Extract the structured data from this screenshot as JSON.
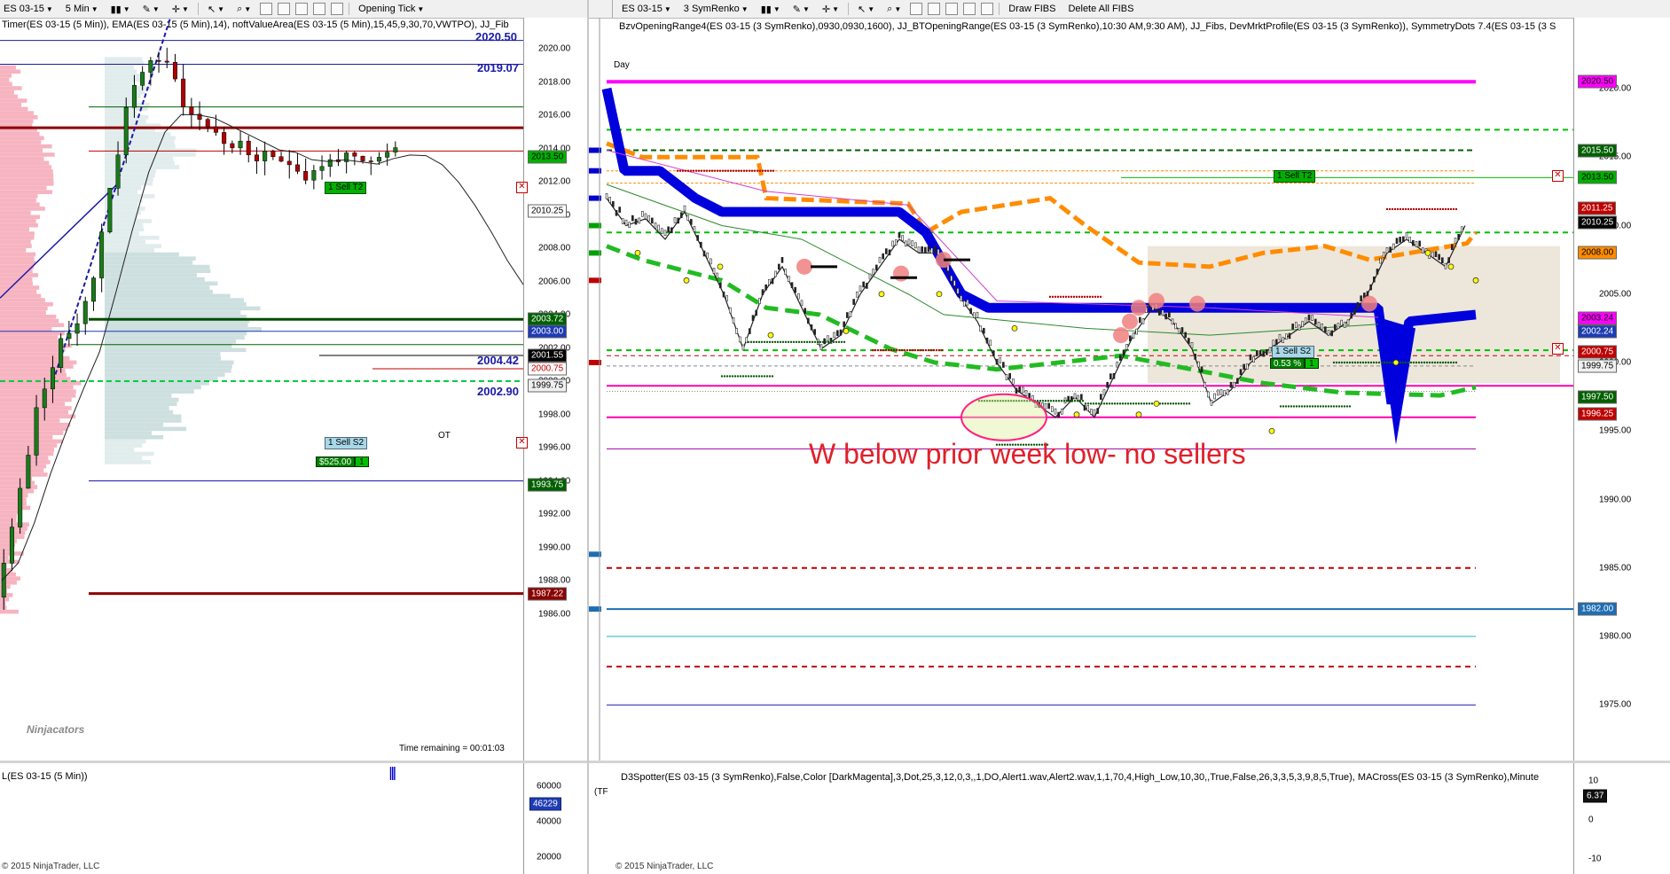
{
  "left_chart": {
    "toolbar": {
      "instrument": "ES 03-15",
      "interval": "5 Min",
      "template": "Opening Tick"
    },
    "indicator_line": "Timer(ES 03-15 (5 Min)), EMA(ES 03-15 (5 Min),14), noftValueArea(ES 03-15 (5 Min),15,45,9,30,70,VWTPO), JJ_Fib",
    "price_labels": [
      "2020.00",
      "2018.00",
      "2016.00",
      "2014.00",
      "2012.00",
      "2010.00",
      "2008.00",
      "2006.00",
      "2004.00",
      "2002.00",
      "2000.00",
      "1998.00",
      "1996.00",
      "1994.00",
      "1992.00",
      "1990.00",
      "1988.00",
      "1986.00"
    ],
    "level_labels": {
      "top": "2020.50",
      "fib1": "2019.07",
      "fib2": "2004.42",
      "fib3": "2002.90"
    },
    "axis_tags": {
      "sell_t2_price": "2013.50",
      "box_2010": "2010.25",
      "green_2003": "2003.72",
      "blue_2003": "2003.00",
      "black_2001": "2001.55",
      "red_2000": "2000.75",
      "gray_1999": "1999.75",
      "green_1993": "1993.75",
      "red_1987": "1987.22"
    },
    "order_labels": {
      "sell_t2": "Sell T2",
      "sell_t2_qty": "1",
      "sell_s2": "Sell S2",
      "sell_s2_qty": "1",
      "pnl": "$525.00",
      "pnl_qty": "1",
      "ot": "OT"
    },
    "watermark": "Ninjacators",
    "time_remaining": "Time remaining = 00:01:03",
    "volume_panel": {
      "label": "L(ES 03-15 (5 Min))",
      "axis_labels": [
        "60000",
        "40000",
        "20000"
      ],
      "current_value": "46229"
    },
    "copyright": "© 2015 NinjaTrader, LLC"
  },
  "right_chart": {
    "toolbar": {
      "instrument": "ES 03-15",
      "interval": "3 SymRenko",
      "draw_fibs": "Draw FIBS",
      "delete_fibs": "Delete All FIBS"
    },
    "indicator_line": "BzvOpeningRange4(ES 03-15 (3 SymRenko),0930,0930,1600), JJ_BTOpeningRange(ES 03-15 (3 SymRenko),10:30 AM,9:30 AM), JJ_Fibs, DevMrktProfile(ES 03-15 (3 SymRenko)), SymmetryDots 7.4(ES 03-15 (3 S",
    "price_labels": [
      "2020.00",
      "2015.00",
      "2010.00",
      "2005.00",
      "2000.00",
      "1995.00",
      "1990.00",
      "1985.00",
      "1980.00",
      "1975.00"
    ],
    "axis_tags": {
      "magenta_2020": "2020.50",
      "green_2015": "2015.50",
      "green_2013": "2013.50",
      "red_2011": "2011.25",
      "black_2010": "2010.25",
      "orange_2008": "2008.00",
      "magenta_2003": "2003.24",
      "blue_2002": "2002.24",
      "red_2000": "2000.75",
      "gray_1999": "1999.75",
      "green_1997": "1997.50",
      "red_1996": "1996.25",
      "blue_1982": "1982.00"
    },
    "order_labels": {
      "sell_t2": "Sell T2",
      "sell_t2_qty": "1",
      "sell_s2": "Sell S2",
      "sell_s2_qty": "1",
      "pct": "0.53 %",
      "pct_qty": "1"
    },
    "annotation": "W below prior week low- no sellers",
    "sub_label": "Day",
    "oscillator": {
      "label": "D3Spotter(ES 03-15 (3 SymRenko),False,Color [DarkMagenta],3,Dot,25,3,12,0,3,,1,DO,Alert1.wav,Alert2.wav,1,1,70,4,High_Low,10,30,,True,False,26,3,3,5,3,9,8,5,True), MACross(ES 03-15 (3 SymRenko),Minute",
      "axis_labels": [
        "10",
        "0",
        "-10"
      ],
      "current_value": "6.37",
      "side_label": "(TF"
    },
    "copyright": "© 2015 NinjaTrader, LLC"
  },
  "colors": {
    "up_candle": "#1a7a1a",
    "down_candle": "#b00000",
    "renko_blue": "#0000dd",
    "orange": "#ff8c00",
    "magenta": "#ff00ff",
    "fib_green": "#00c000",
    "fib_red": "#d00000",
    "profile_pink": "#f4a0b0",
    "value_area": "#c8dcdc",
    "annotation_red": "#e0202a",
    "oscillator_blue": "#0000cc",
    "oscillator_red": "#cc0000",
    "oscillator_bg_pink": "#ffc8c8",
    "oscillator_bg_green": "#c8f0c8"
  }
}
